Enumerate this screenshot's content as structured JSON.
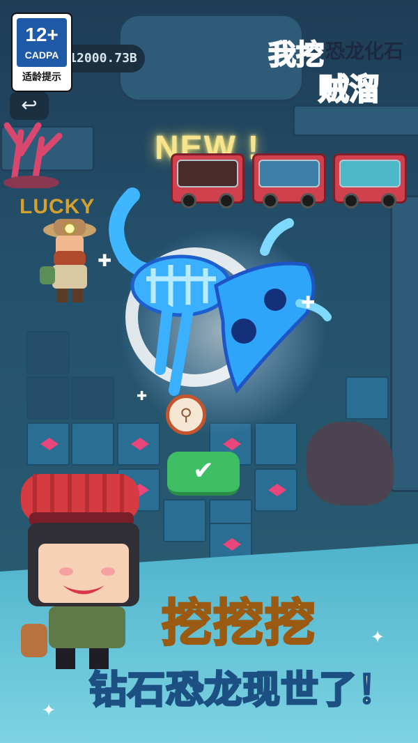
{
  "app": {
    "logo_line1": "我挖",
    "logo_line2": "恐龙化石",
    "logo_line3": "贼溜"
  },
  "age_rating": {
    "number": "12+",
    "org": "CADPA",
    "hint": "适龄提示"
  },
  "hud": {
    "currency": "12000.73B",
    "back_icon": "back-arrow-icon"
  },
  "game": {
    "new_label": "NEW !",
    "lucky_label": "LUCKY",
    "confirm_icon": "checkmark-icon",
    "bone_icon": "bone-icon"
  },
  "promo": {
    "slogan_main": "挖挖挖",
    "slogan_sub": "钻石恐龙现世了！"
  },
  "colors": {
    "confirm": "#3fbf63",
    "headline": "#fde04a",
    "accent_red": "#d1404d"
  }
}
